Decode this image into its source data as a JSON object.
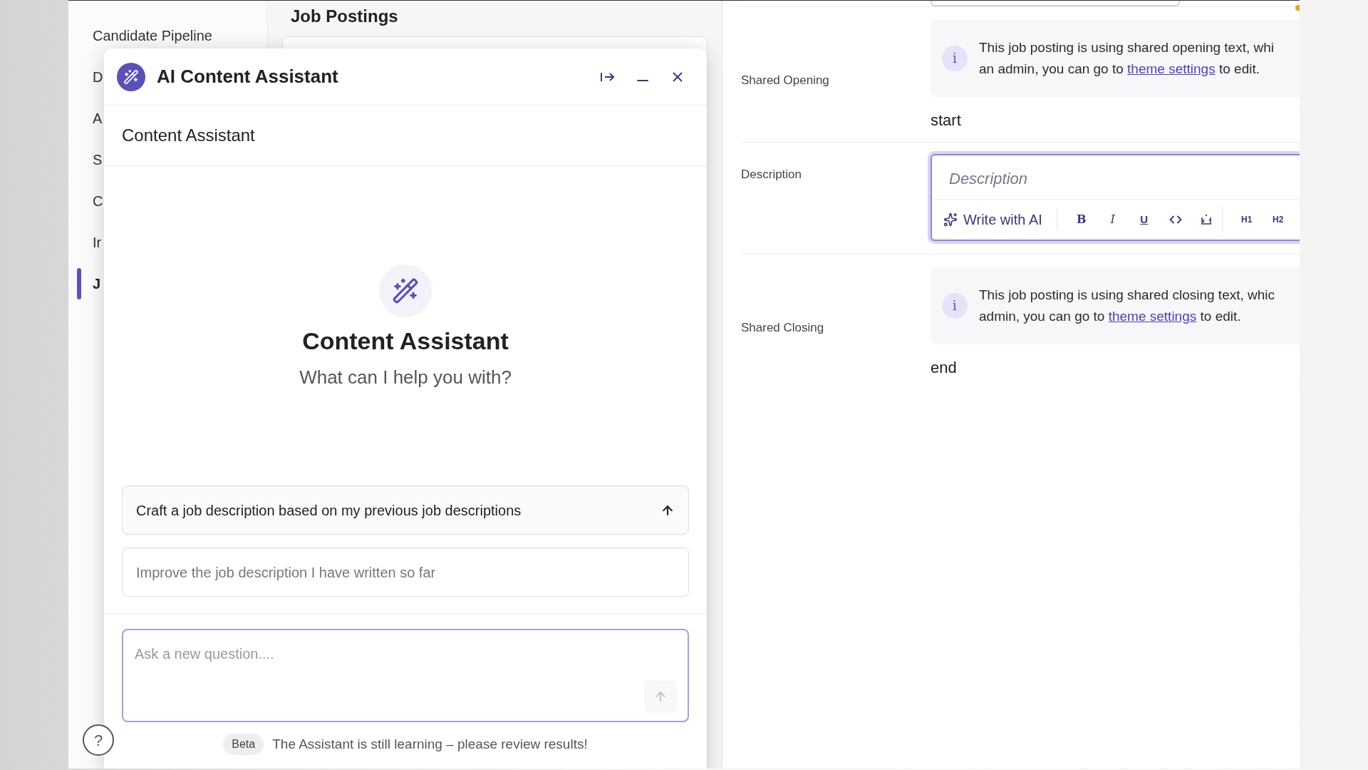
{
  "page_heading": "Job Postings",
  "sidebar": {
    "items": [
      {
        "label": "Candidate Pipeline",
        "selected": false
      },
      {
        "label": "D",
        "selected": false
      },
      {
        "label": "A",
        "selected": false
      },
      {
        "label": "S",
        "selected": false
      },
      {
        "label": "C",
        "selected": false
      },
      {
        "label": "Ir",
        "selected": false
      },
      {
        "label": "J",
        "selected": true
      }
    ]
  },
  "form": {
    "rows": [
      {
        "kind": "notice",
        "label": "Shared Opening",
        "notice": {
          "icon": "i",
          "line1": "This job posting is using shared opening text, whi",
          "line2_before": "an admin, you can go to",
          "link": "theme settings",
          "line2_after": "to edit."
        },
        "value": "start"
      },
      {
        "kind": "editor",
        "label": "Description",
        "placeholder": "Description",
        "toolbar": {
          "ai_button": "Write with AI",
          "bold": "B",
          "italic": "I",
          "underline": "U",
          "h1": "H1",
          "h2": "H2"
        }
      },
      {
        "kind": "notice",
        "label": "Shared Closing",
        "notice": {
          "icon": "i",
          "line1": "This job posting is using shared closing text, whic",
          "line2_before": "admin, you can go to",
          "link": "theme settings",
          "line2_after": "to edit."
        },
        "value": "end"
      }
    ]
  },
  "assistant": {
    "title": "AI Content Assistant",
    "subheader": "Content Assistant",
    "hero_title": "Content Assistant",
    "hero_subtitle": "What can I help you with?",
    "suggestions": [
      {
        "text": "Craft a job description based on my previous job descriptions",
        "hovered": true
      },
      {
        "text": "Improve the job description I have written so far",
        "hovered": false
      }
    ],
    "input": {
      "placeholder": "Ask a new question....",
      "send_disabled": true
    },
    "footer": {
      "badge": "Beta",
      "note": "The Assistant is still learning – please review results!"
    }
  },
  "help_button": "?"
}
